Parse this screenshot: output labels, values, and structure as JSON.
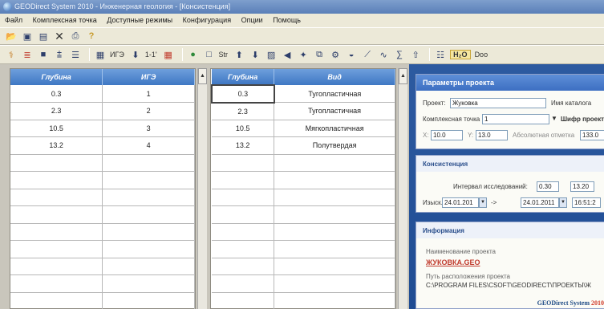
{
  "window": {
    "title": "GEODirect System 2010 - Инженерная геология - [Консистенция]"
  },
  "menu": [
    "Файл",
    "Комплексная точка",
    "Доступные режимы",
    "Конфигурация",
    "Опции",
    "Помощь"
  ],
  "toolbar2": {
    "ige_label": "ИГЭ",
    "range_label": "1-1'",
    "str_label": "Str",
    "h2o_label": "H₂O",
    "doo_label": "Doo"
  },
  "grid_left": {
    "headers": [
      "Глубина",
      "ИГЭ"
    ],
    "rows": [
      [
        "0.3",
        "1"
      ],
      [
        "2.3",
        "2"
      ],
      [
        "10.5",
        "3"
      ],
      [
        "13.2",
        "4"
      ]
    ]
  },
  "grid_right": {
    "headers": [
      "Глубина",
      "Вид"
    ],
    "rows": [
      [
        "0.3",
        "Тугопластичная"
      ],
      [
        "2.3",
        "Тугопластичная"
      ],
      [
        "10.5",
        "Мягкопластичная"
      ],
      [
        "13.2",
        "Полутвердая"
      ]
    ]
  },
  "project_panel": {
    "title": "Параметры проекта",
    "project_label": "Проект:",
    "project_value": "Жуковка",
    "catalog_label": "Имя каталога",
    "point_label": "Комплексная точка",
    "point_value": "1",
    "cipher_label": "Шифр проекта",
    "x_label": "X:",
    "x_value": "10.0",
    "y_label": "Y:",
    "y_value": "13.0",
    "abs_label": "Абсолютная отметка",
    "abs_value": "133.0"
  },
  "consistency_panel": {
    "title": "Консистенция",
    "interval_label": "Интервал исследований:",
    "interval_from": "0.30",
    "interval_to": "13.20",
    "survey_label": "Изыск.",
    "date_from": "24.01.201",
    "arrow": "->",
    "date_to": "24.01.2011",
    "time_to": "16:51:2"
  },
  "info_panel": {
    "title": "Информация",
    "name_label": "Наименование проекта",
    "name_value": "ЖУКОВКА.GEO",
    "path_label": "Путь расположения проекта",
    "path_value": "C:\\PROGRAM FILES\\CSOFT\\GEODIRECT\\ПРОЕКТЫ\\Ж",
    "logo_text": "GEODirect System",
    "logo_year": "2010"
  },
  "colors": {
    "accent": "#3f78c4",
    "panel_bg": "#1f4c93",
    "link": "#c0392b"
  }
}
